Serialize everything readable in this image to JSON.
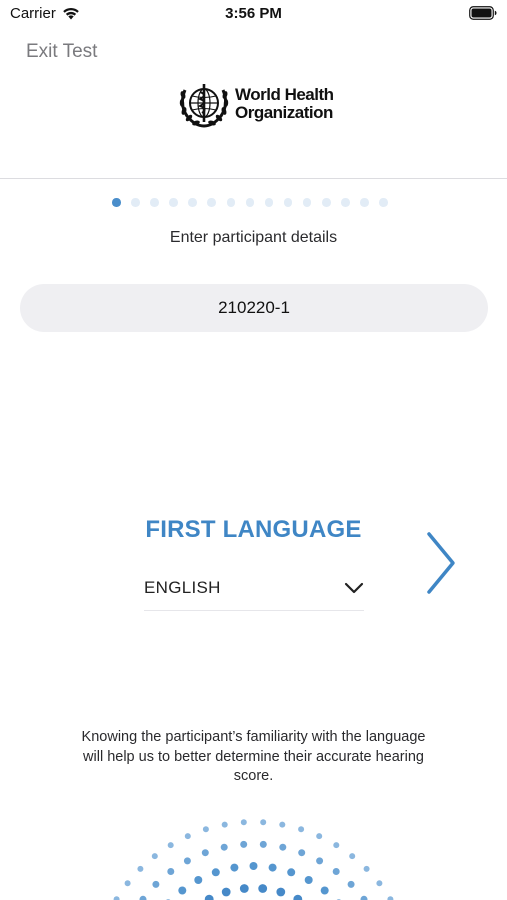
{
  "status_bar": {
    "carrier": "Carrier",
    "time": "3:56 PM",
    "icons": [
      "wifi-icon",
      "battery-icon"
    ]
  },
  "header": {
    "exit_label": "Exit Test",
    "logo_line1": "World Health",
    "logo_line2": "Organization"
  },
  "progress": {
    "current_step": 1,
    "total_steps": 15
  },
  "participant": {
    "section_title": "Enter participant details",
    "id_value": "210220-1"
  },
  "language": {
    "heading": "FIRST LANGUAGE",
    "selected": "ENGLISH",
    "next_icon": "chevron-right-icon"
  },
  "info": {
    "text": "Knowing the participant’s familiarity with the language will help us to better determine their accurate hearing score."
  },
  "colors": {
    "accent": "#3f86c5",
    "field_bg": "#efeff2",
    "inactive_dot": "#e2ecf6",
    "active_dot": "#4a8ecb"
  }
}
